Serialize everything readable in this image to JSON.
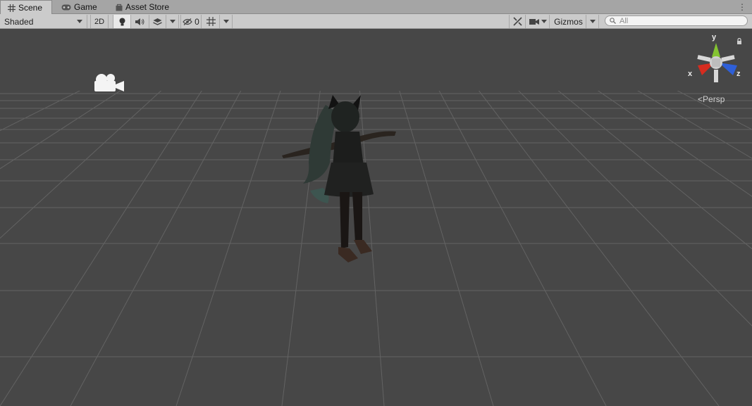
{
  "tabs": [
    {
      "label": "Scene",
      "icon": "grid-icon"
    },
    {
      "label": "Game",
      "icon": "gamepad-icon"
    },
    {
      "label": "Asset Store",
      "icon": "shopping-bag-icon"
    }
  ],
  "toolbar": {
    "draw_mode": "Shaded",
    "mode_2d": "2D",
    "hidden_count": "0",
    "gizmos": "Gizmos",
    "search_placeholder": "All"
  },
  "gizmo": {
    "x": "x",
    "y": "y",
    "z": "z",
    "projection": "Persp"
  },
  "colors": {
    "viewport": "#474747",
    "axis_x": "#d62c1f",
    "axis_y": "#84c431",
    "axis_z": "#2e5fd8"
  }
}
